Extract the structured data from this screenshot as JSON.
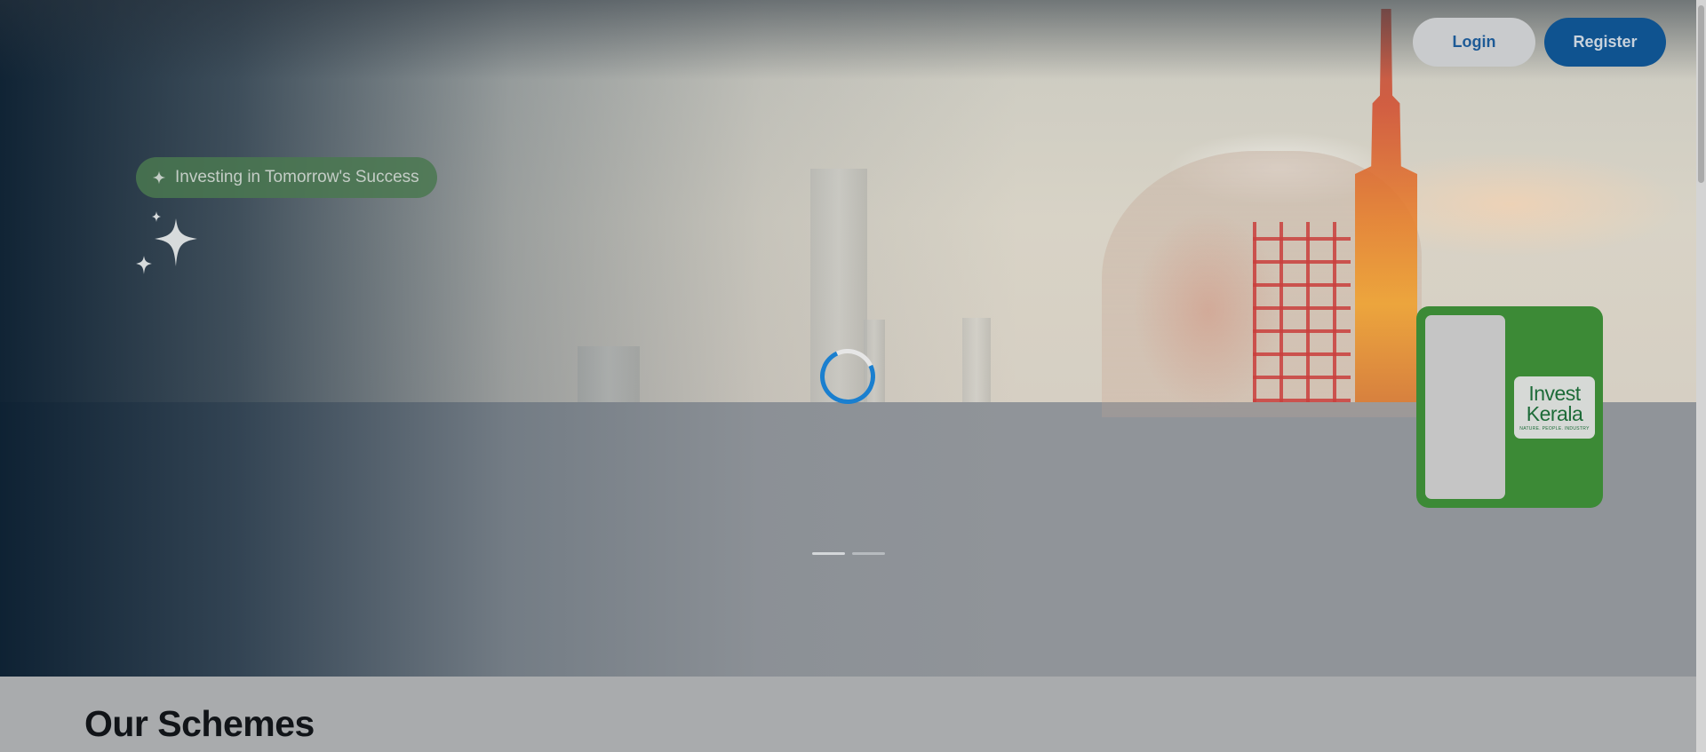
{
  "header": {
    "login_label": "Login",
    "register_label": "Register"
  },
  "hero": {
    "tagline": "Investing in Tomorrow's Success",
    "carousel": {
      "slides": 2,
      "active_index": 0
    },
    "loading": true
  },
  "promo_card": {
    "logo_line1": "Invest",
    "logo_line2": "Kerala",
    "logo_tagline": "NATURE. PEOPLE. INDUSTRY",
    "background_color": "#3c8a36"
  },
  "sections": {
    "schemes_title": "Our Schemes"
  },
  "colors": {
    "primary": "#0f5390",
    "accent_green": "#3c8a36",
    "spinner": "#1a7fcf"
  },
  "icons": {
    "tagline_icon": "sparkle-icon",
    "decor_icon": "sparkles-icon"
  }
}
